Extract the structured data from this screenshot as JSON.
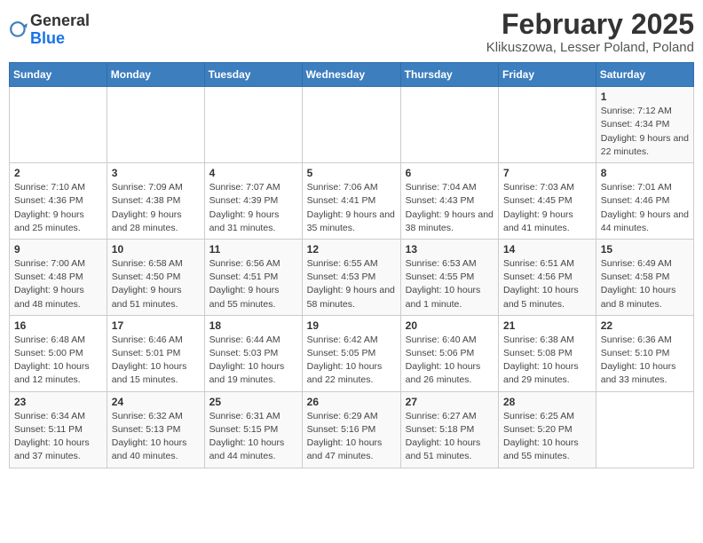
{
  "header": {
    "logo_general": "General",
    "logo_blue": "Blue",
    "title": "February 2025",
    "subtitle": "Klikuszowa, Lesser Poland, Poland"
  },
  "weekdays": [
    "Sunday",
    "Monday",
    "Tuesday",
    "Wednesday",
    "Thursday",
    "Friday",
    "Saturday"
  ],
  "weeks": [
    [
      {
        "day": "",
        "info": ""
      },
      {
        "day": "",
        "info": ""
      },
      {
        "day": "",
        "info": ""
      },
      {
        "day": "",
        "info": ""
      },
      {
        "day": "",
        "info": ""
      },
      {
        "day": "",
        "info": ""
      },
      {
        "day": "1",
        "info": "Sunrise: 7:12 AM\nSunset: 4:34 PM\nDaylight: 9 hours and 22 minutes."
      }
    ],
    [
      {
        "day": "2",
        "info": "Sunrise: 7:10 AM\nSunset: 4:36 PM\nDaylight: 9 hours and 25 minutes."
      },
      {
        "day": "3",
        "info": "Sunrise: 7:09 AM\nSunset: 4:38 PM\nDaylight: 9 hours and 28 minutes."
      },
      {
        "day": "4",
        "info": "Sunrise: 7:07 AM\nSunset: 4:39 PM\nDaylight: 9 hours and 31 minutes."
      },
      {
        "day": "5",
        "info": "Sunrise: 7:06 AM\nSunset: 4:41 PM\nDaylight: 9 hours and 35 minutes."
      },
      {
        "day": "6",
        "info": "Sunrise: 7:04 AM\nSunset: 4:43 PM\nDaylight: 9 hours and 38 minutes."
      },
      {
        "day": "7",
        "info": "Sunrise: 7:03 AM\nSunset: 4:45 PM\nDaylight: 9 hours and 41 minutes."
      },
      {
        "day": "8",
        "info": "Sunrise: 7:01 AM\nSunset: 4:46 PM\nDaylight: 9 hours and 44 minutes."
      }
    ],
    [
      {
        "day": "9",
        "info": "Sunrise: 7:00 AM\nSunset: 4:48 PM\nDaylight: 9 hours and 48 minutes."
      },
      {
        "day": "10",
        "info": "Sunrise: 6:58 AM\nSunset: 4:50 PM\nDaylight: 9 hours and 51 minutes."
      },
      {
        "day": "11",
        "info": "Sunrise: 6:56 AM\nSunset: 4:51 PM\nDaylight: 9 hours and 55 minutes."
      },
      {
        "day": "12",
        "info": "Sunrise: 6:55 AM\nSunset: 4:53 PM\nDaylight: 9 hours and 58 minutes."
      },
      {
        "day": "13",
        "info": "Sunrise: 6:53 AM\nSunset: 4:55 PM\nDaylight: 10 hours and 1 minute."
      },
      {
        "day": "14",
        "info": "Sunrise: 6:51 AM\nSunset: 4:56 PM\nDaylight: 10 hours and 5 minutes."
      },
      {
        "day": "15",
        "info": "Sunrise: 6:49 AM\nSunset: 4:58 PM\nDaylight: 10 hours and 8 minutes."
      }
    ],
    [
      {
        "day": "16",
        "info": "Sunrise: 6:48 AM\nSunset: 5:00 PM\nDaylight: 10 hours and 12 minutes."
      },
      {
        "day": "17",
        "info": "Sunrise: 6:46 AM\nSunset: 5:01 PM\nDaylight: 10 hours and 15 minutes."
      },
      {
        "day": "18",
        "info": "Sunrise: 6:44 AM\nSunset: 5:03 PM\nDaylight: 10 hours and 19 minutes."
      },
      {
        "day": "19",
        "info": "Sunrise: 6:42 AM\nSunset: 5:05 PM\nDaylight: 10 hours and 22 minutes."
      },
      {
        "day": "20",
        "info": "Sunrise: 6:40 AM\nSunset: 5:06 PM\nDaylight: 10 hours and 26 minutes."
      },
      {
        "day": "21",
        "info": "Sunrise: 6:38 AM\nSunset: 5:08 PM\nDaylight: 10 hours and 29 minutes."
      },
      {
        "day": "22",
        "info": "Sunrise: 6:36 AM\nSunset: 5:10 PM\nDaylight: 10 hours and 33 minutes."
      }
    ],
    [
      {
        "day": "23",
        "info": "Sunrise: 6:34 AM\nSunset: 5:11 PM\nDaylight: 10 hours and 37 minutes."
      },
      {
        "day": "24",
        "info": "Sunrise: 6:32 AM\nSunset: 5:13 PM\nDaylight: 10 hours and 40 minutes."
      },
      {
        "day": "25",
        "info": "Sunrise: 6:31 AM\nSunset: 5:15 PM\nDaylight: 10 hours and 44 minutes."
      },
      {
        "day": "26",
        "info": "Sunrise: 6:29 AM\nSunset: 5:16 PM\nDaylight: 10 hours and 47 minutes."
      },
      {
        "day": "27",
        "info": "Sunrise: 6:27 AM\nSunset: 5:18 PM\nDaylight: 10 hours and 51 minutes."
      },
      {
        "day": "28",
        "info": "Sunrise: 6:25 AM\nSunset: 5:20 PM\nDaylight: 10 hours and 55 minutes."
      },
      {
        "day": "",
        "info": ""
      }
    ]
  ]
}
